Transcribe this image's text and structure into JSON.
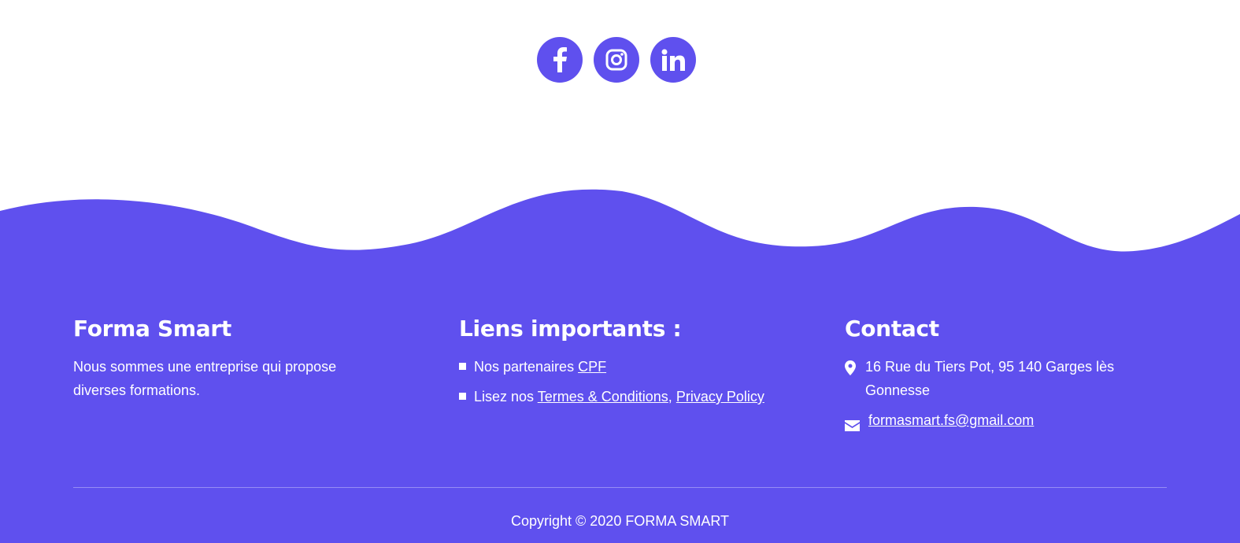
{
  "colors": {
    "accent": "#5f50ee",
    "text_on_accent": "#ffffff",
    "page_background": "#ffffff"
  },
  "social": [
    {
      "name": "facebook",
      "icon": "facebook-icon"
    },
    {
      "name": "instagram",
      "icon": "instagram-icon"
    },
    {
      "name": "linkedin",
      "icon": "linkedin-icon"
    }
  ],
  "about": {
    "title": "Forma Smart",
    "text": "Nous sommes une entreprise qui propose diverses formations."
  },
  "links": {
    "title": "Liens importants :",
    "item1_prefix": "Nos partenaires ",
    "item1_link": "CPF",
    "item2_prefix": "Lisez nos ",
    "item2_link1": "Termes & Conditions",
    "item2_separator": ",",
    "item2_link2": "Privacy Policy"
  },
  "contact": {
    "title": "Contact",
    "address": "16 Rue du Tiers Pot, 95 140 Garges lès Gonnesse",
    "address_icon": "map-marker-icon",
    "email": "formasmart.fs@gmail.com",
    "email_icon": "envelope-icon"
  },
  "copyright": "Copyright © 2020 FORMA SMART"
}
